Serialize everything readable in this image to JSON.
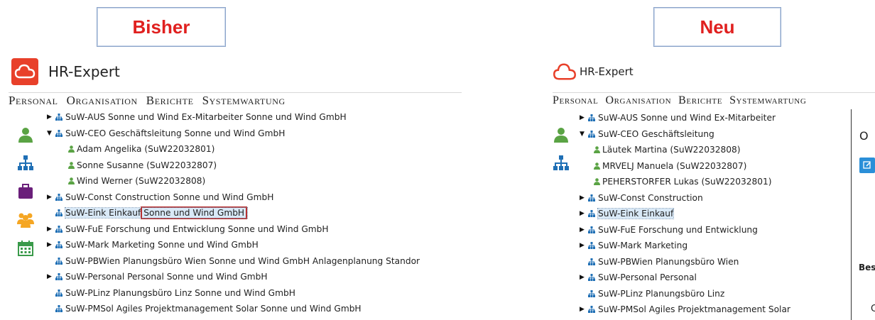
{
  "labels": {
    "before": "Bisher",
    "after": "Neu"
  },
  "app_title": "HR-Expert",
  "menu": [
    "Personal",
    "Organisation",
    "Berichte",
    "Systemwartung"
  ],
  "colors": {
    "accent_red": "#e0201f",
    "logo_red": "#e8402a",
    "org_blue": "#1f6fb5",
    "person_green": "#5aa344",
    "selection": "#d9e9f7"
  },
  "sidebar_icons": [
    "person-icon",
    "org-chart-icon",
    "briefcase-icon",
    "group-icon",
    "calendar-icon"
  ],
  "old_tree": [
    {
      "type": "org",
      "arrow": "▶",
      "label": "SuW-AUS Sonne und Wind Ex-Mitarbeiter Sonne und Wind GmbH"
    },
    {
      "type": "org",
      "arrow": "▼",
      "label": "SuW-CEO Geschäftsleitung Sonne und Wind GmbH"
    },
    {
      "type": "person",
      "label": "Adam Angelika (SuW22032801)"
    },
    {
      "type": "person",
      "label": "Sonne Susanne (SuW22032807)"
    },
    {
      "type": "person",
      "label": "Wind Werner (SuW22032808)"
    },
    {
      "type": "org",
      "arrow": "▶",
      "label": "SuW-Const Construction Sonne und Wind GmbH"
    },
    {
      "type": "org",
      "arrow": "",
      "label": "SuW-Eink Einkauf",
      "highlight": "Sonne und Wind GmbH",
      "selected": true
    },
    {
      "type": "org",
      "arrow": "▶",
      "label": "SuW-FuE Forschung und Entwicklung Sonne und Wind GmbH"
    },
    {
      "type": "org",
      "arrow": "▶",
      "label": "SuW-Mark Marketing Sonne und Wind GmbH"
    },
    {
      "type": "org",
      "arrow": "",
      "label": "SuW-PBWien Planungsbüro Wien Sonne und Wind GmbH Anlagenplanung Standor"
    },
    {
      "type": "org",
      "arrow": "▶",
      "label": "SuW-Personal Personal Sonne und Wind GmbH"
    },
    {
      "type": "org",
      "arrow": "",
      "label": "SuW-PLinz Planungsbüro Linz Sonne und Wind GmbH"
    },
    {
      "type": "org",
      "arrow": "",
      "label": "SuW-PMSol Agiles Projektmanagement Solar Sonne und Wind GmbH"
    }
  ],
  "new_tree": [
    {
      "type": "org",
      "arrow": "▶",
      "label": "SuW-AUS Sonne und Wind Ex-Mitarbeiter"
    },
    {
      "type": "org",
      "arrow": "▼",
      "label": "SuW-CEO Geschäftsleitung"
    },
    {
      "type": "person",
      "label": "Läutek Martina (SuW22032808)"
    },
    {
      "type": "person",
      "label": "MRVELJ Manuela (SuW22032807)"
    },
    {
      "type": "person",
      "label": "PEHERSTORFER Lukas (SuW22032801)"
    },
    {
      "type": "org",
      "arrow": "▶",
      "label": "SuW-Const Construction"
    },
    {
      "type": "org",
      "arrow": "▶",
      "label": "SuW-Eink Einkauf",
      "selected": true
    },
    {
      "type": "org",
      "arrow": "▶",
      "label": "SuW-FuE Forschung und Entwicklung"
    },
    {
      "type": "org",
      "arrow": "▶",
      "label": "SuW-Mark Marketing"
    },
    {
      "type": "org",
      "arrow": "",
      "label": "SuW-PBWien Planungsbüro Wien"
    },
    {
      "type": "org",
      "arrow": "▶",
      "label": "SuW-Personal Personal"
    },
    {
      "type": "org",
      "arrow": "",
      "label": "SuW-PLinz Planungsbüro Linz"
    },
    {
      "type": "org",
      "arrow": "▶",
      "label": "SuW-PMSol Agiles Projektmanagement Solar"
    }
  ],
  "new_side_fragments": {
    "o": "O",
    "bes": "Bes",
    "c": "C"
  }
}
